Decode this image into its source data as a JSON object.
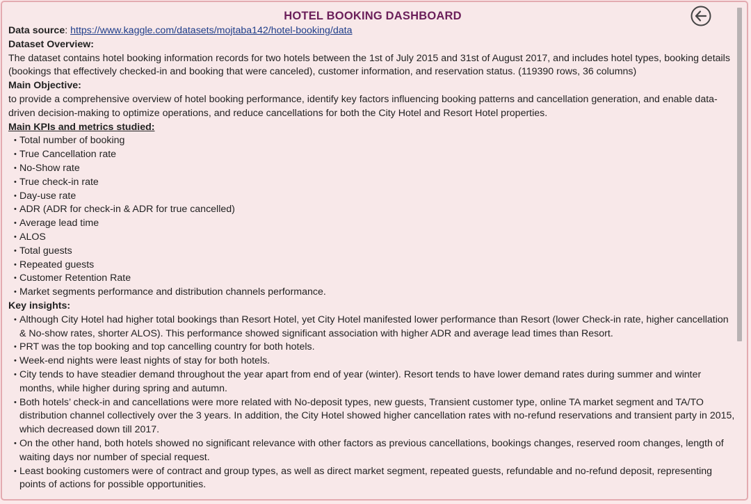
{
  "header": {
    "title": "HOTEL BOOKING DASHBOARD",
    "back_icon": "circle-arrow-left-icon"
  },
  "source": {
    "label": "Data source",
    "separator": ": ",
    "url": "https://www.kaggle.com/datasets/mojtaba142/hotel-booking/data"
  },
  "overview": {
    "heading": "Dataset Overview:",
    "text": "The dataset contains hotel booking information records for two hotels between the 1st of July 2015 and 31st of August 2017, and includes hotel types, booking details (bookings that effectively checked-in and booking that were canceled), customer information, and reservation status. (119390 rows, 36 columns)"
  },
  "objective": {
    "heading": "Main Objective:",
    "text": "to provide a comprehensive overview of hotel booking performance, identify key factors influencing booking patterns and cancellation generation, and enable data-driven decision-making to optimize operations, and reduce cancellations for both the City Hotel and Resort Hotel properties."
  },
  "kpis": {
    "heading": "Main KPIs and metrics studied:",
    "items": [
      "Total number of booking",
      "True Cancellation rate",
      "No-Show rate",
      "True check-in rate",
      "Day-use rate",
      "ADR (ADR for check-in & ADR for true cancelled)",
      "Average lead time",
      "ALOS",
      "Total guests",
      "Repeated guests",
      "Customer Retention Rate",
      "Market segments performance and distribution channels performance."
    ]
  },
  "insights": {
    "heading": "Key insights:",
    "items": [
      "Although City Hotel had higher total bookings than Resort Hotel, yet City Hotel manifested lower performance than Resort (lower Check-in rate, higher cancellation & No-show rates, shorter ALOS). This performance showed significant association with higher ADR and average lead times than Resort.",
      "PRT was the top booking and top cancelling country for both hotels.",
      "Week-end nights were least nights of stay for both hotels.",
      "City tends to have steadier demand throughout the year apart from end of year (winter). Resort tends to have lower demand rates during summer and winter months, while higher during spring and autumn.",
      "Both hotels’ check-in and cancellations were more related with No-deposit types, new guests, Transient customer type, online TA market segment and TA/TO distribution channel collectively over the 3 years. In addition, the City Hotel showed higher cancellation rates with no-refund reservations and transient party in 2015, which decreased down till 2017.",
      "On the other hand, both hotels showed no significant relevance with other factors as previous cancellations, bookings changes, reserved room changes, length of waiting days nor number of special request.",
      "Least booking customers were of contract and group types, as well as direct market segment, repeated guests, refundable and no-refund deposit, representing points of actions for possible opportunities."
    ]
  }
}
